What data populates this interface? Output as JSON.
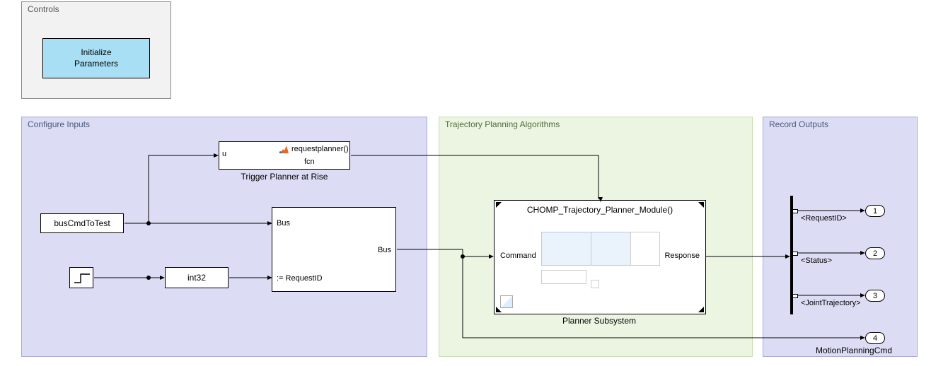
{
  "diagram": {
    "regions": {
      "controls": {
        "title": "Controls"
      },
      "configure": {
        "title": "Configure Inputs"
      },
      "trajectory": {
        "title": "Trajectory Planning Algorithms"
      },
      "record": {
        "title": "Record Outputs"
      }
    },
    "blocks": {
      "init_button": {
        "line1": "Initialize",
        "line2": "Parameters"
      },
      "trigger_block": {
        "port_in": "u",
        "fcn_text": "requestplanner()",
        "fcn_sub": "fcn",
        "label": "Trigger Planner at Rise"
      },
      "buscmd": {
        "text": "busCmdToTest"
      },
      "int32": {
        "text": "int32"
      },
      "bus_assign": {
        "in1": "Bus",
        "in2": ":= RequestID",
        "out": "Bus"
      },
      "planner": {
        "title": "CHOMP_Trajectory_Planner_Module()",
        "port_in": "Command",
        "port_out": "Response",
        "label": "Planner Subsystem"
      },
      "bus_selector": {
        "sig1": "<RequestID>",
        "sig2": "<Status>",
        "sig3": "<JointTrajectory>"
      },
      "outports": {
        "p1": "1",
        "p2": "2",
        "p3": "3",
        "p4": "4",
        "p4_label": "MotionPlanningCmd"
      }
    }
  }
}
